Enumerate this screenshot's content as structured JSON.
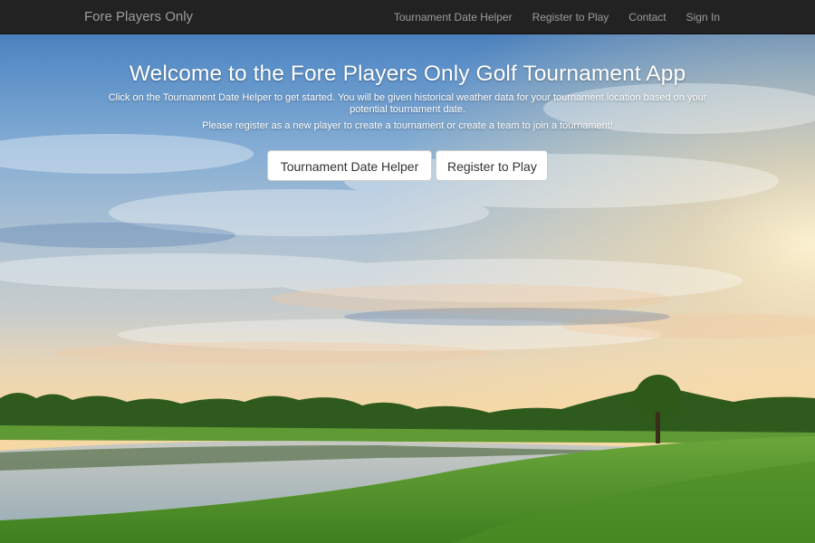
{
  "navbar": {
    "brand": "Fore Players Only",
    "links": [
      {
        "label": "Tournament Date Helper"
      },
      {
        "label": "Register to Play"
      },
      {
        "label": "Contact"
      },
      {
        "label": "Sign In"
      }
    ]
  },
  "hero": {
    "title": "Welcome to the Fore Players Only Golf Tournament App",
    "description_1": "Click on the Tournament Date Helper to get started. You will be given historical weather data for your tournament location based on your potential tournament date.",
    "description_2": "Please register as a new player to create a tournament or create a team to join a tournament!",
    "buttons": {
      "date_helper": "Tournament Date Helper",
      "register": "Register to Play"
    }
  },
  "background": {
    "description_colors": {
      "sky_top": "#3f78b8",
      "sky_horizon": "#f3d7a6",
      "grass": "#4e8f2a",
      "water": "#b9c3c8",
      "navbar": "#222222"
    }
  }
}
